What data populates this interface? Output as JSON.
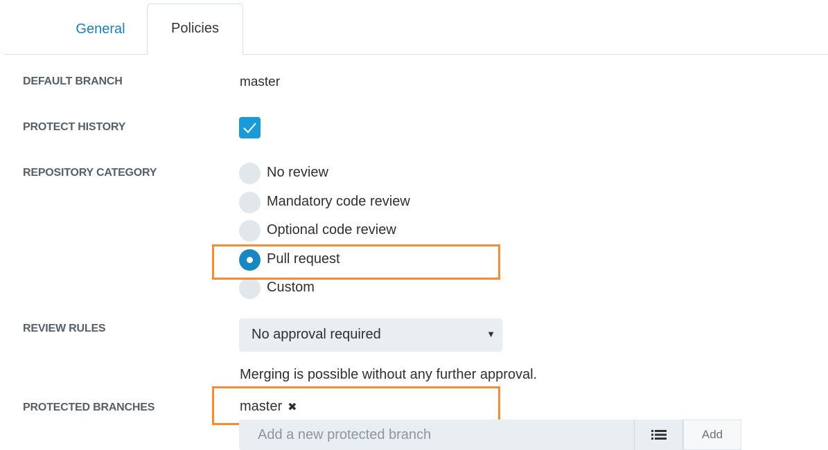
{
  "tabs": [
    {
      "label": "General",
      "active": false
    },
    {
      "label": "Policies",
      "active": true
    }
  ],
  "fields": {
    "default_branch": {
      "label": "DEFAULT BRANCH",
      "value": "master"
    },
    "protect_history": {
      "label": "PROTECT HISTORY",
      "checked": true
    },
    "repository_category": {
      "label": "REPOSITORY CATEGORY",
      "options": [
        "No review",
        "Mandatory code review",
        "Optional code review",
        "Pull request",
        "Custom"
      ],
      "selected": "Pull request"
    },
    "review_rules": {
      "label": "REVIEW RULES",
      "selected": "No approval required",
      "hint": "Merging is possible without any further approval."
    },
    "protected_branches": {
      "label": "PROTECTED BRANCHES",
      "branches": [
        "master"
      ],
      "input_placeholder": "Add a new protected branch",
      "add_label": "Add"
    }
  },
  "colors": {
    "accent": "#1a9bd7",
    "tab_link": "#1a7fb2",
    "highlight": "#f68b32",
    "control_bg": "#e8eef1"
  }
}
